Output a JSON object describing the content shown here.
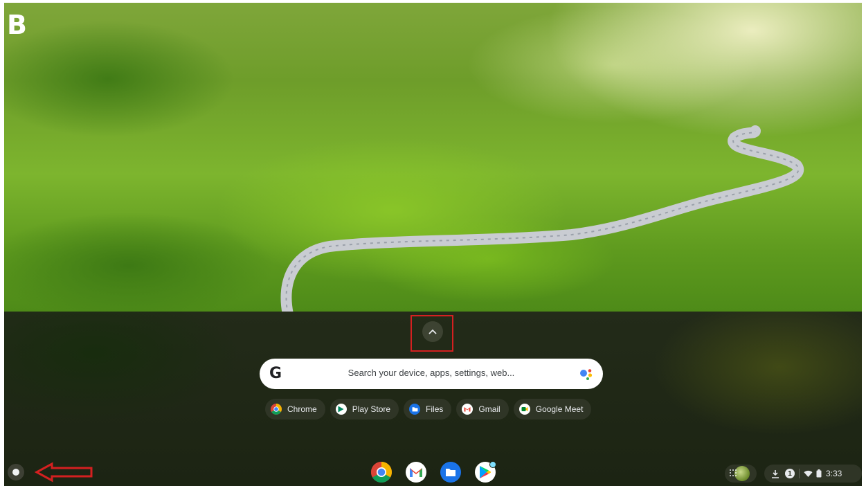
{
  "label_letter": "B",
  "search": {
    "placeholder": "Search your device, apps, settings, web..."
  },
  "suggestions": [
    {
      "label": "Chrome",
      "icon": "chrome-icon"
    },
    {
      "label": "Play Store",
      "icon": "play-store-icon"
    },
    {
      "label": "Files",
      "icon": "files-icon"
    },
    {
      "label": "Gmail",
      "icon": "gmail-icon"
    },
    {
      "label": "Google Meet",
      "icon": "google-meet-icon"
    }
  ],
  "shelf": {
    "pinned_apps": [
      "Chrome",
      "Gmail",
      "Files",
      "Play Store"
    ],
    "tray": {
      "notification_count": "1",
      "time": "3:33"
    }
  },
  "colors": {
    "annotation_red": "#d42020",
    "chip_bg": "#2f3526"
  }
}
